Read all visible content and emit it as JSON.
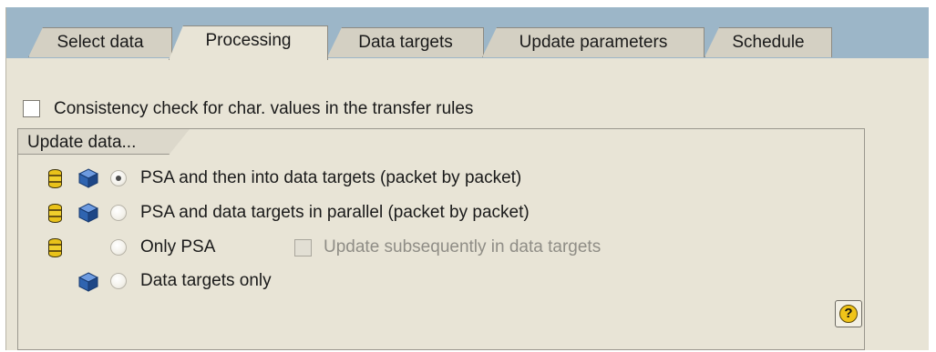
{
  "tabs": [
    {
      "label": "Select data"
    },
    {
      "label": "Processing"
    },
    {
      "label": "Data targets"
    },
    {
      "label": "Update parameters"
    },
    {
      "label": "Schedule"
    }
  ],
  "consistency_check": {
    "label": "Consistency check for char. values in the transfer rules",
    "checked": false
  },
  "update_group": {
    "title": "Update data...",
    "options": [
      {
        "label": "PSA and then into data targets (packet by packet)",
        "selected": true
      },
      {
        "label": "PSA and data targets in parallel (packet by packet)",
        "selected": false
      },
      {
        "label": "Only PSA",
        "selected": false
      },
      {
        "label": "Data targets only",
        "selected": false
      }
    ],
    "subsequent_update": {
      "label": "Update subsequently in data targets",
      "enabled": false
    }
  },
  "help_button": {
    "label": "?"
  },
  "colors": {
    "tab_strip": "#9cb6c8",
    "panel": "#e8e4d6",
    "db_icon": "#e9c21a",
    "cube_icon": "#2f64b0"
  }
}
